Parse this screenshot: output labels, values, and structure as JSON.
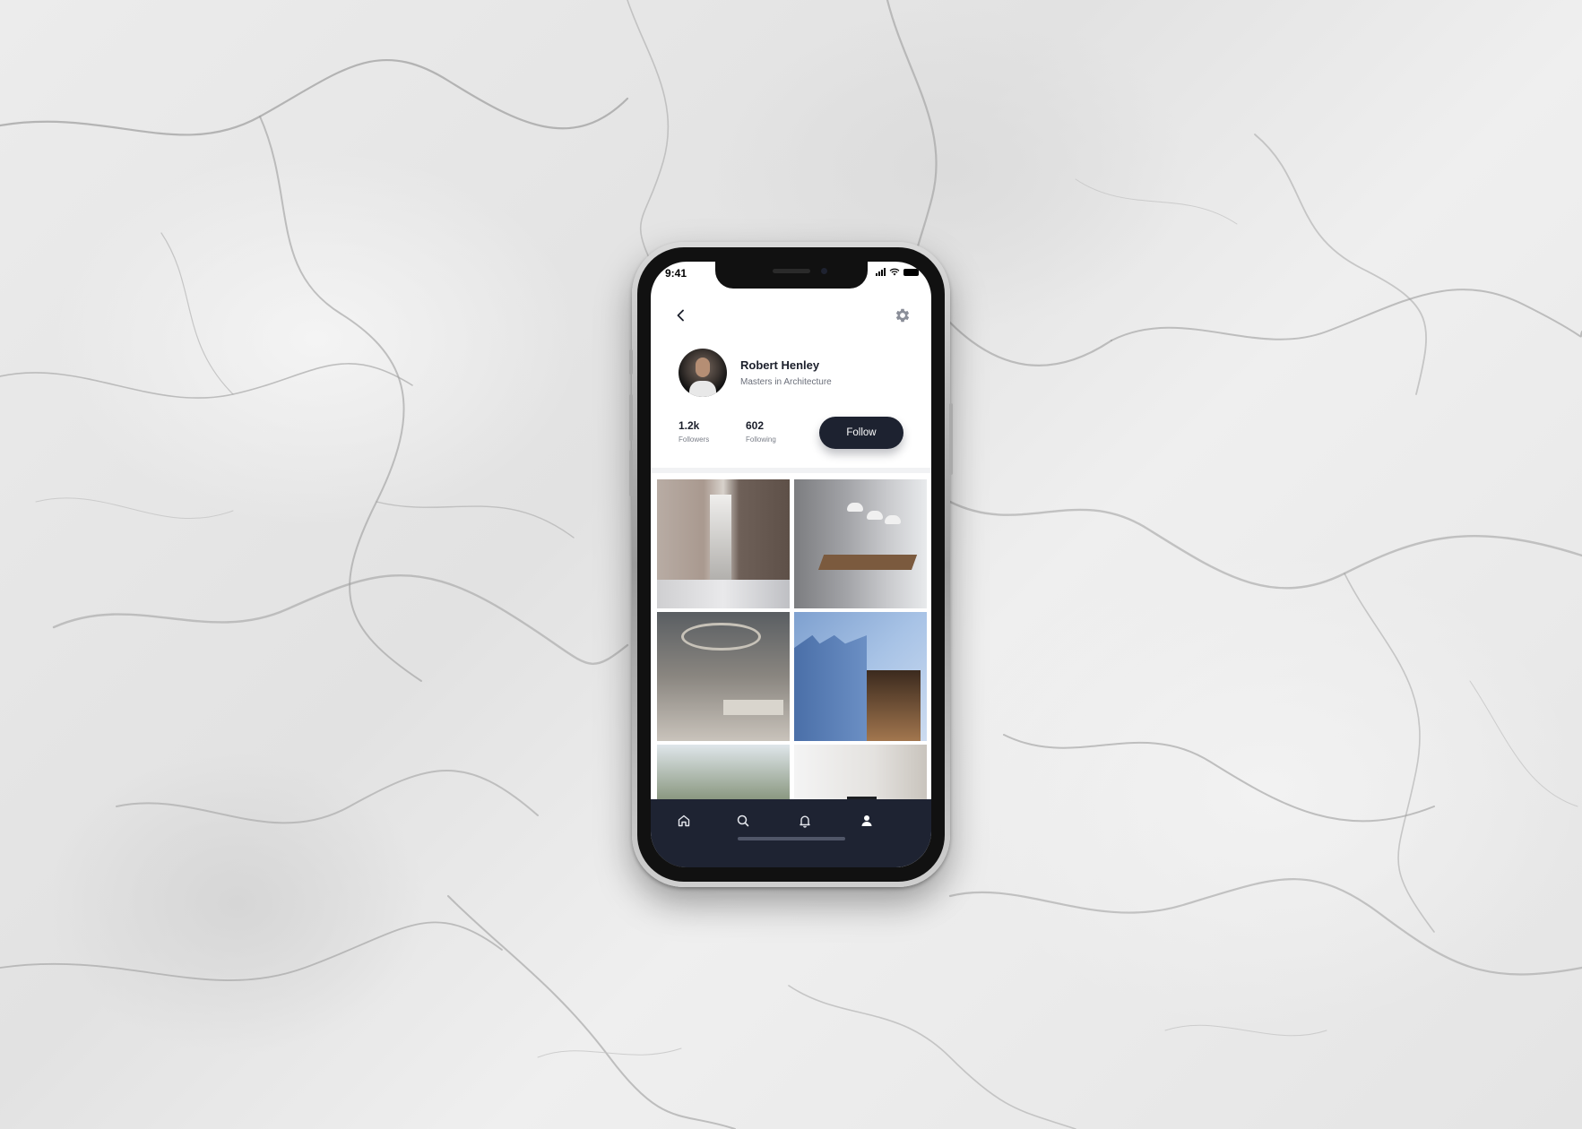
{
  "status_bar": {
    "time": "9:41"
  },
  "header": {
    "back_icon": "chevron-left-icon",
    "settings_icon": "gear-icon"
  },
  "profile": {
    "name": "Robert Henley",
    "subtitle": "Masters in Architecture",
    "followers_count": "1.2k",
    "followers_label": "Followers",
    "following_count": "602",
    "following_label": "Following",
    "follow_label": "Follow"
  },
  "gallery": {
    "tiles": [
      {
        "name": "interior-marble-hallway"
      },
      {
        "name": "dining-room-pendants"
      },
      {
        "name": "living-room-ring-light"
      },
      {
        "name": "blue-facade-exterior"
      },
      {
        "name": "atrium-plants"
      },
      {
        "name": "white-room-chandelier"
      }
    ]
  },
  "tabbar": {
    "items": [
      {
        "icon": "home-icon",
        "active": false
      },
      {
        "icon": "search-icon",
        "active": false
      },
      {
        "icon": "bell-icon",
        "active": false
      },
      {
        "icon": "user-icon",
        "active": true
      }
    ]
  },
  "colors": {
    "primary_dark": "#1d2230",
    "tabbar": "#1e2332",
    "text_primary": "#1b1f2b",
    "text_secondary": "#6b6f7a",
    "background": "#ffffff"
  }
}
